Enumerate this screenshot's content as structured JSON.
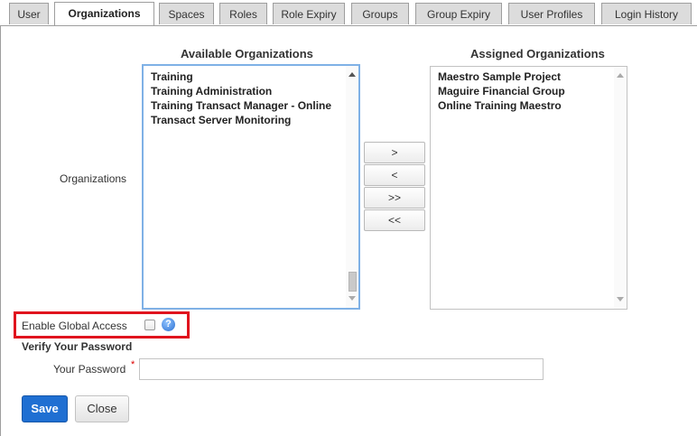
{
  "tabs": [
    {
      "label": "User"
    },
    {
      "label": "Organizations"
    },
    {
      "label": "Spaces"
    },
    {
      "label": "Roles"
    },
    {
      "label": "Role Expiry"
    },
    {
      "label": "Groups"
    },
    {
      "label": "Group Expiry"
    },
    {
      "label": "User Profiles"
    },
    {
      "label": "Login History"
    }
  ],
  "active_tab": "Organizations",
  "organizations_label": "Organizations",
  "available": {
    "heading": "Available Organizations",
    "items": [
      "Training",
      "Training Administration",
      "Training Transact Manager - Online",
      "Transact Server Monitoring"
    ]
  },
  "assigned": {
    "heading": "Assigned Organizations",
    "items": [
      "Maestro Sample Project",
      "Maguire Financial Group",
      "Online Training Maestro"
    ]
  },
  "move_buttons": {
    "add": ">",
    "remove": "<",
    "add_all": ">>",
    "remove_all": "<<"
  },
  "global_access": {
    "label": "Enable Global Access",
    "checked": false,
    "help_icon": "?"
  },
  "verify": {
    "heading": "Verify Your Password",
    "password_label": "Your Password",
    "required_mark": "*",
    "password_value": ""
  },
  "actions": {
    "save": "Save",
    "close": "Close"
  }
}
